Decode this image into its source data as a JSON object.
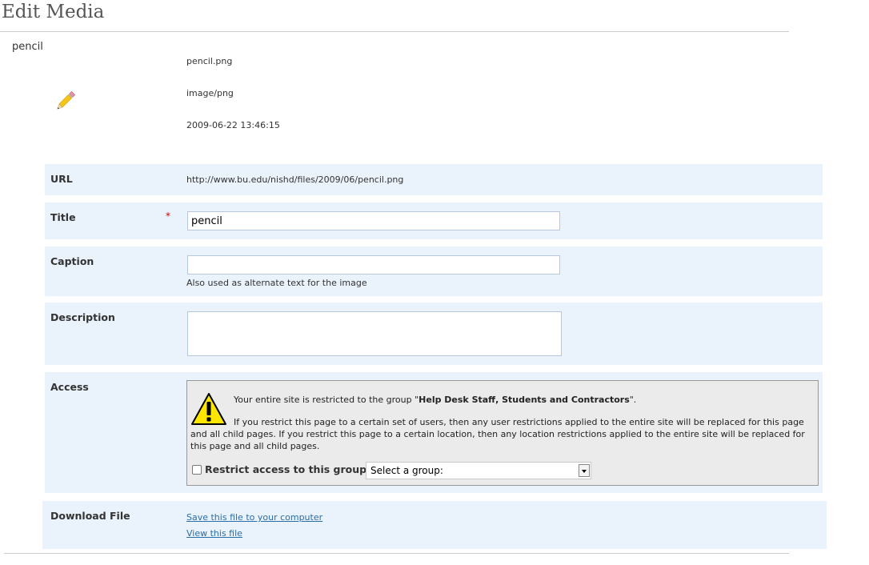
{
  "page": {
    "title": "Edit Media"
  },
  "media": {
    "name": "pencil",
    "filename": "pencil.png",
    "mime_type": "image/png",
    "date": "2009-06-22 13:46:15",
    "thumbnail_icon": "pencil-icon"
  },
  "form": {
    "url": {
      "label": "URL",
      "value": "http://www.bu.edu/nishd/files/2009/06/pencil.png"
    },
    "title": {
      "label": "Title",
      "required_mark": "*",
      "value": "pencil"
    },
    "caption": {
      "label": "Caption",
      "value": "",
      "help": "Also used as alternate text for the image"
    },
    "description": {
      "label": "Description",
      "value": ""
    },
    "access": {
      "label": "Access",
      "warning_icon": "warning-icon",
      "notice_prefix": "Your entire site is restricted to the group \"",
      "notice_group": "Help Desk Staff, Students and Contractors",
      "notice_suffix": "\".",
      "notice_detail": "If you restrict this page to a certain set of users, then any user restrictions applied to the entire site will be replaced for this page and all child pages. If you restrict this page to a certain location, then any location restrictions applied to the entire site will be replaced for this page and all child pages.",
      "restrict_label": "Restrict access to this group:",
      "restrict_checked": false,
      "group_select_value": "Select a group:"
    },
    "download": {
      "label": "Download File",
      "save_link": "Save this file to your computer",
      "view_link": "View this file"
    }
  },
  "colors": {
    "row_background": "#eaf2fb",
    "link": "#2a6ea8",
    "required": "#cc0000",
    "warning_yellow": "#ffe600"
  }
}
